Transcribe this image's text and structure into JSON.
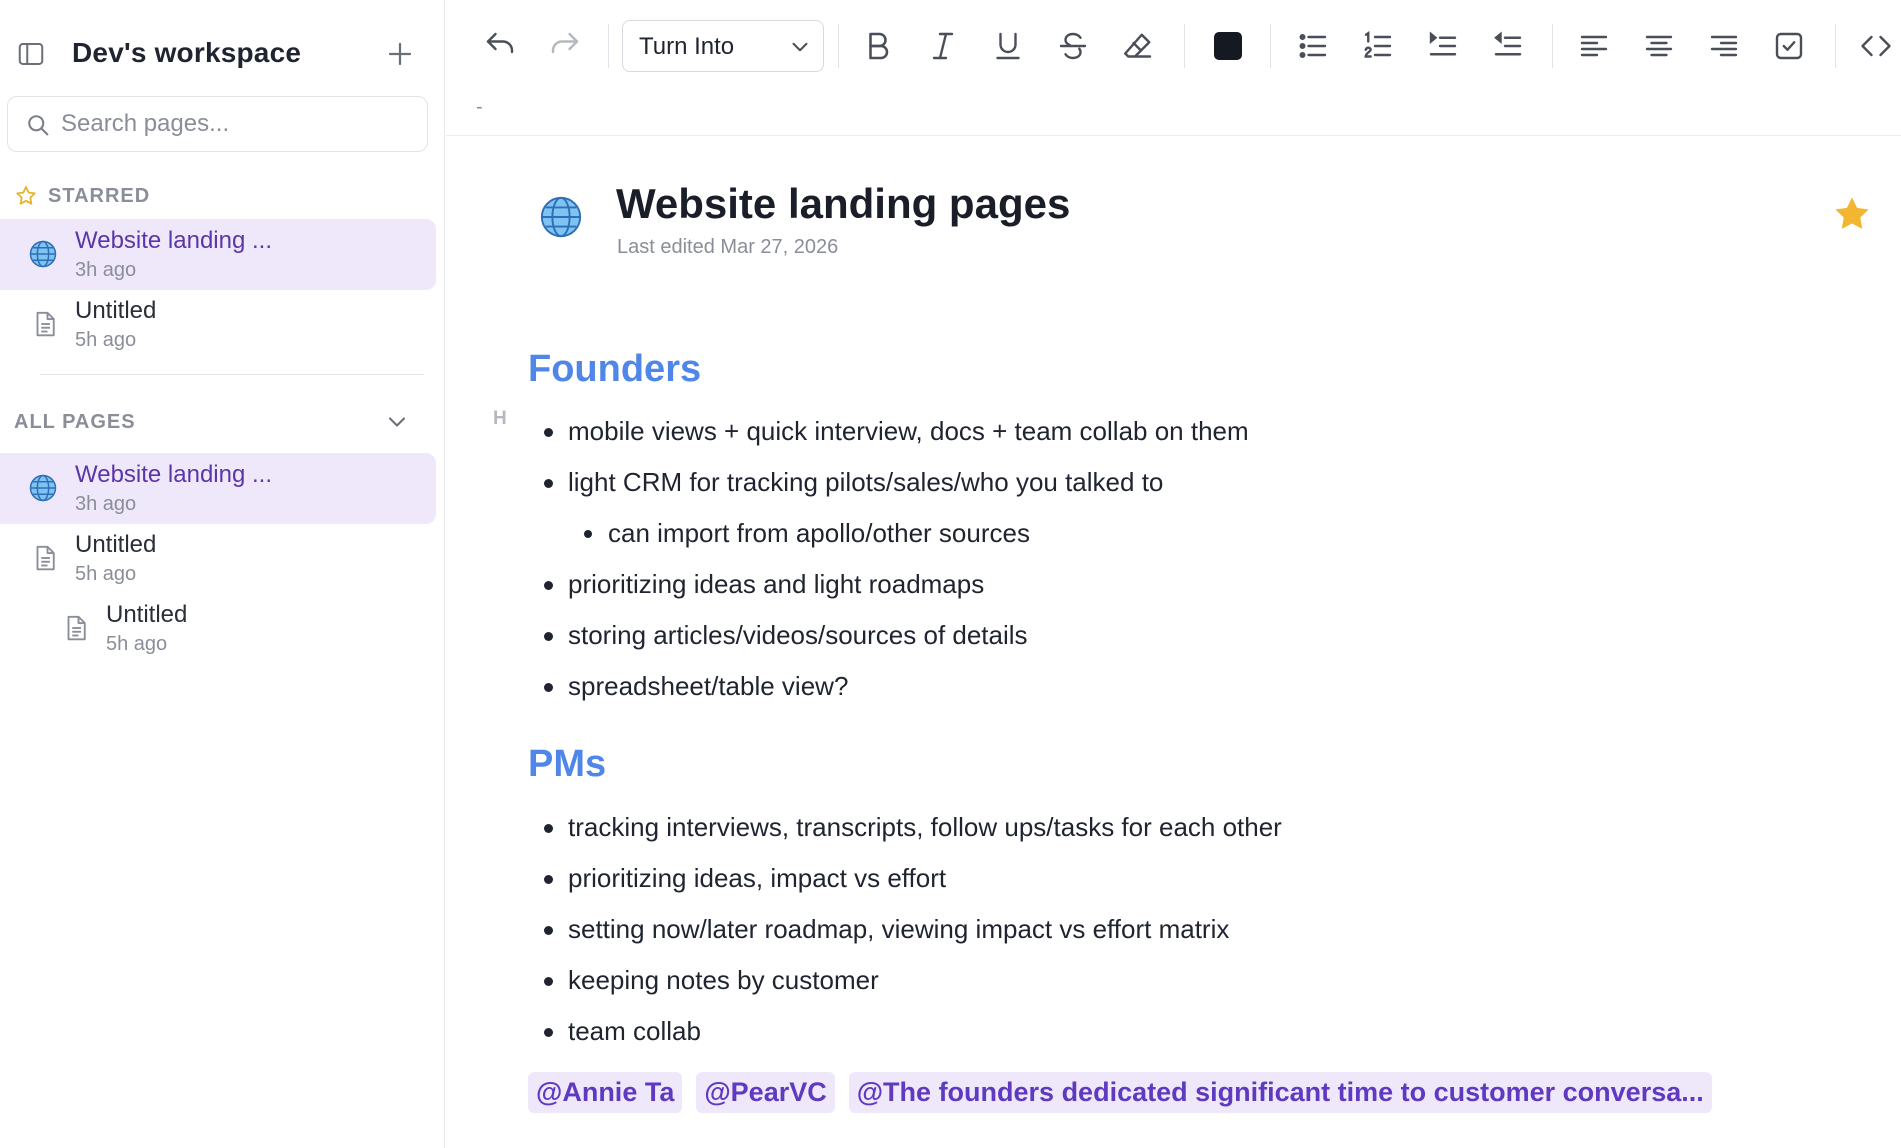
{
  "sidebar": {
    "workspace_name": "Dev's workspace",
    "search_placeholder": "Search pages...",
    "starred_label": "STARRED",
    "all_pages_label": "ALL PAGES",
    "starred": [
      {
        "title": "Website landing ...",
        "time": "3h ago",
        "icon": "globe-icon",
        "active": true
      },
      {
        "title": "Untitled",
        "time": "5h ago",
        "icon": "document-icon",
        "active": false
      }
    ],
    "all_pages": [
      {
        "title": "Website landing ...",
        "time": "3h ago",
        "icon": "globe-icon",
        "active": true
      },
      {
        "title": "Untitled",
        "time": "5h ago",
        "icon": "document-icon",
        "active": false
      },
      {
        "title": "Untitled",
        "time": "5h ago",
        "icon": "document-icon",
        "active": false
      }
    ]
  },
  "toolbar": {
    "turn_into_label": "Turn Into",
    "text_color": "#151922",
    "buttons": [
      "undo-icon",
      "redo-icon",
      "bold-icon",
      "italic-icon",
      "underline-icon",
      "strikethrough-icon",
      "eraser-icon",
      "bullet-list-icon",
      "numbered-list-icon",
      "indent-icon",
      "outdent-icon",
      "align-left-icon",
      "align-center-icon",
      "align-right-icon",
      "checkbox-icon",
      "code-icon"
    ]
  },
  "subbar_mark": "-",
  "document": {
    "title": "Website landing pages",
    "last_edited": "Last edited Mar 27, 2026",
    "starred": true,
    "block_handle": "H",
    "sections": [
      {
        "heading": "Founders",
        "items": [
          {
            "text": "mobile views + quick interview, docs + team collab on them",
            "level": 0
          },
          {
            "text": "light CRM for tracking pilots/sales/who you talked to",
            "level": 0
          },
          {
            "text": "can import from apollo/other sources",
            "level": 1
          },
          {
            "text": "prioritizing ideas and light roadmaps",
            "level": 0
          },
          {
            "text": "storing articles/videos/sources of details",
            "level": 0
          },
          {
            "text": "spreadsheet/table view?",
            "level": 0
          }
        ]
      },
      {
        "heading": "PMs",
        "items": [
          {
            "text": "tracking interviews, transcripts, follow ups/tasks for each other",
            "level": 0
          },
          {
            "text": "prioritizing ideas, impact vs effort",
            "level": 0
          },
          {
            "text": "setting now/later roadmap, viewing impact vs effort matrix",
            "level": 0
          },
          {
            "text": "keeping notes by customer",
            "level": 0
          },
          {
            "text": "team collab",
            "level": 0
          }
        ]
      }
    ],
    "mentions": [
      "@Annie Ta",
      "@PearVC",
      "@The founders dedicated significant time to customer conversa..."
    ]
  },
  "colors": {
    "accent_purple": "#5b36a8",
    "active_bg": "#efe8fb",
    "heading_blue": "#4f86e8",
    "star_yellow": "#f2b632"
  }
}
